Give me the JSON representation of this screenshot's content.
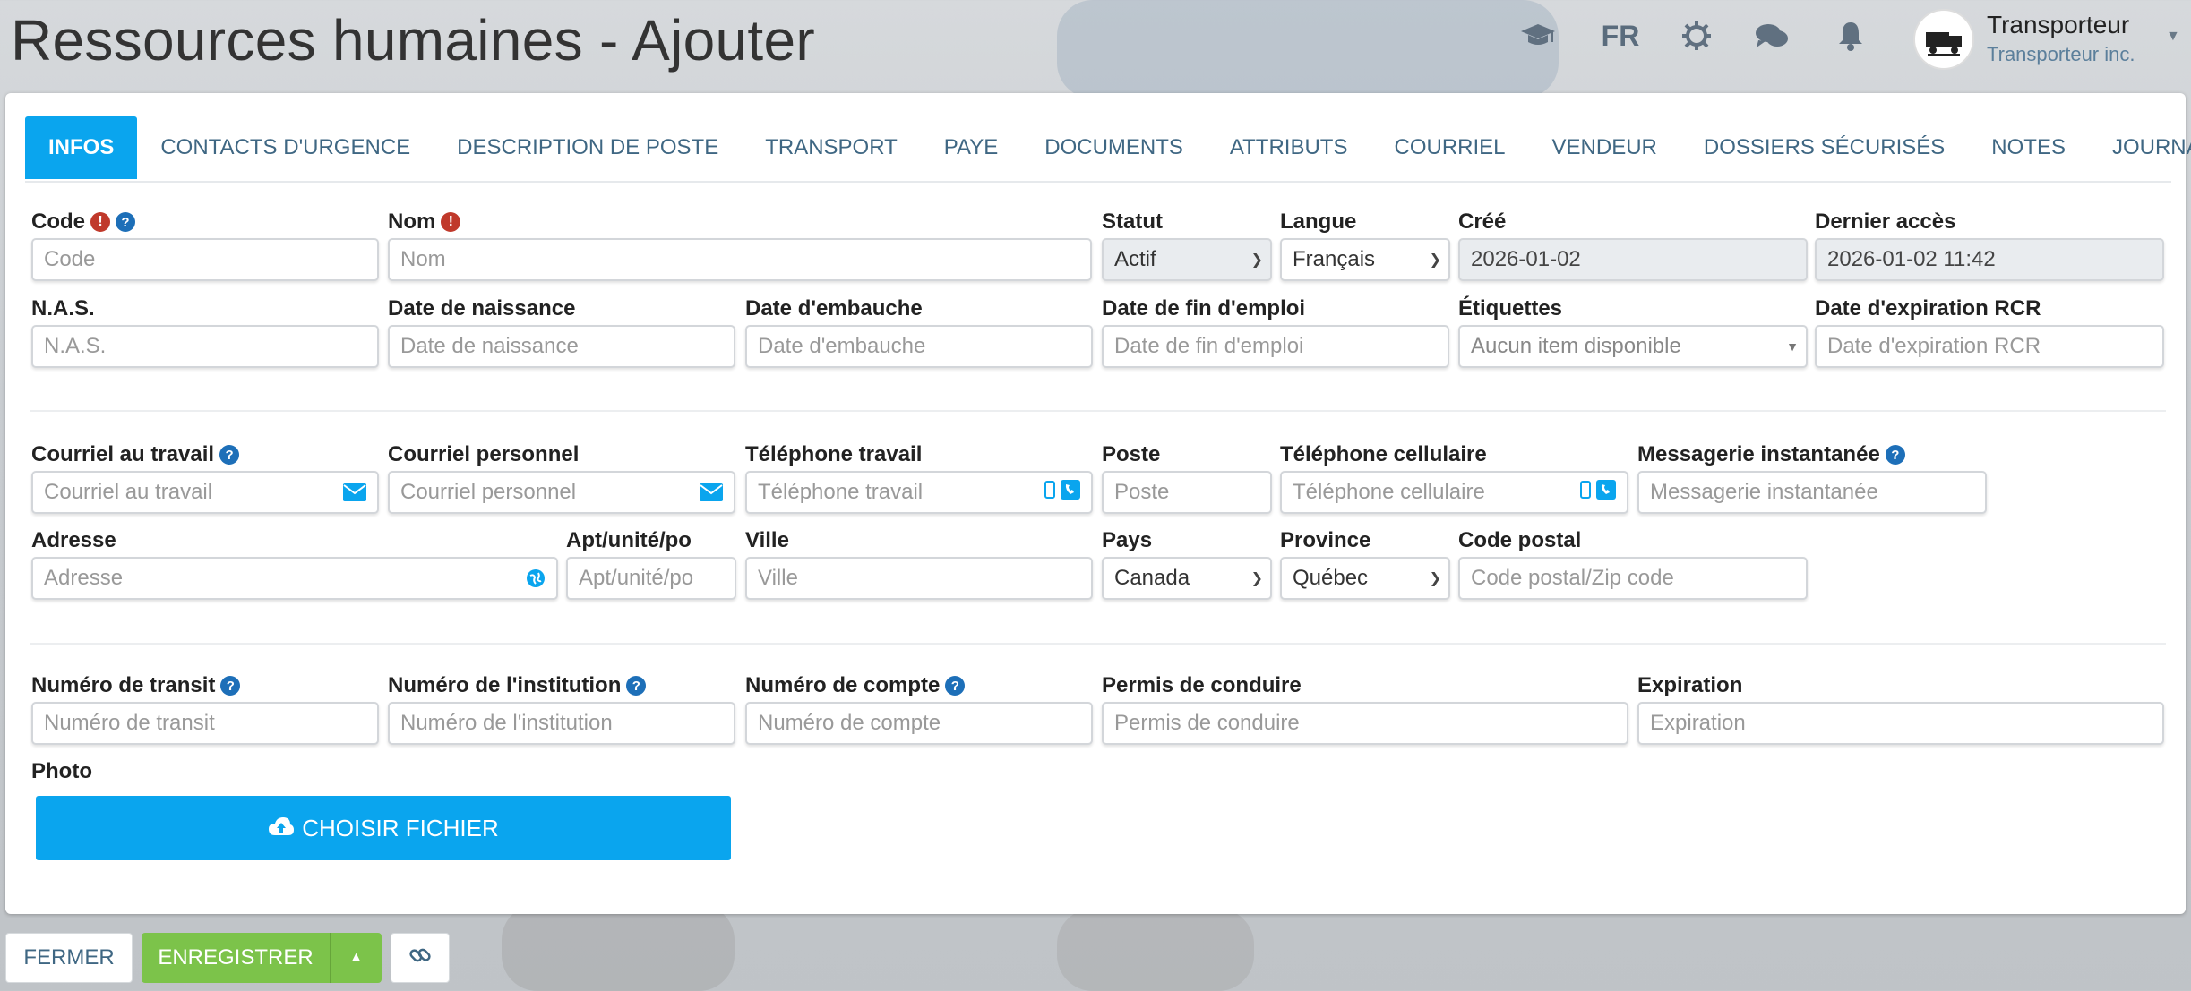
{
  "header": {
    "title": "Ressources humaines - Ajouter",
    "lang": "FR",
    "user_name": "Transporteur",
    "user_org": "Transporteur inc."
  },
  "tabs": [
    "INFOS",
    "CONTACTS D'URGENCE",
    "DESCRIPTION DE POSTE",
    "TRANSPORT",
    "PAYE",
    "DOCUMENTS",
    "ATTRIBUTS",
    "COURRIEL",
    "VENDEUR",
    "DOSSIERS SÉCURISÉS",
    "NOTES",
    "JOURNAL"
  ],
  "active_tab": "INFOS",
  "form": {
    "code": {
      "label": "Code",
      "placeholder": "Code"
    },
    "nom": {
      "label": "Nom",
      "placeholder": "Nom"
    },
    "statut": {
      "label": "Statut",
      "value": "Actif"
    },
    "langue": {
      "label": "Langue",
      "value": "Français"
    },
    "cree": {
      "label": "Créé",
      "value": "2026-01-02"
    },
    "dernier_acces": {
      "label": "Dernier accès",
      "value": "2026-01-02 11:42"
    },
    "nas": {
      "label": "N.A.S.",
      "placeholder": "N.A.S."
    },
    "date_naissance": {
      "label": "Date de naissance",
      "placeholder": "Date de naissance"
    },
    "date_embauche": {
      "label": "Date d'embauche",
      "placeholder": "Date d'embauche"
    },
    "date_fin": {
      "label": "Date de fin d'emploi",
      "placeholder": "Date de fin d'emploi"
    },
    "etiquettes": {
      "label": "Étiquettes",
      "placeholder": "Aucun item disponible"
    },
    "rcr": {
      "label": "Date d'expiration RCR",
      "placeholder": "Date d'expiration RCR"
    },
    "courriel_travail": {
      "label": "Courriel au travail",
      "placeholder": "Courriel au travail"
    },
    "courriel_perso": {
      "label": "Courriel personnel",
      "placeholder": "Courriel personnel"
    },
    "tel_travail": {
      "label": "Téléphone travail",
      "placeholder": "Téléphone travail"
    },
    "poste": {
      "label": "Poste",
      "placeholder": "Poste"
    },
    "tel_cell": {
      "label": "Téléphone cellulaire",
      "placeholder": "Téléphone cellulaire"
    },
    "messagerie": {
      "label": "Messagerie instantanée",
      "placeholder": "Messagerie instantanée"
    },
    "adresse": {
      "label": "Adresse",
      "placeholder": "Adresse"
    },
    "apt": {
      "label": "Apt/unité/po",
      "placeholder": "Apt/unité/po"
    },
    "ville": {
      "label": "Ville",
      "placeholder": "Ville"
    },
    "pays": {
      "label": "Pays",
      "value": "Canada"
    },
    "province": {
      "label": "Province",
      "value": "Québec"
    },
    "code_postal": {
      "label": "Code postal",
      "placeholder": "Code postal/Zip code"
    },
    "transit": {
      "label": "Numéro de transit",
      "placeholder": "Numéro de transit"
    },
    "institution": {
      "label": "Numéro de l'institution",
      "placeholder": "Numéro de l'institution"
    },
    "compte": {
      "label": "Numéro de compte",
      "placeholder": "Numéro de compte"
    },
    "permis": {
      "label": "Permis de conduire",
      "placeholder": "Permis de conduire"
    },
    "expiration": {
      "label": "Expiration",
      "placeholder": "Expiration"
    },
    "photo": {
      "label": "Photo",
      "button": "CHOISIR FICHIER"
    }
  },
  "footer": {
    "close": "FERMER",
    "save": "ENREGISTRER"
  },
  "colors": {
    "accent": "#0aa5ee",
    "save_green": "#7cc34a",
    "error_red": "#c0392b",
    "help_blue": "#1d6fb8"
  }
}
